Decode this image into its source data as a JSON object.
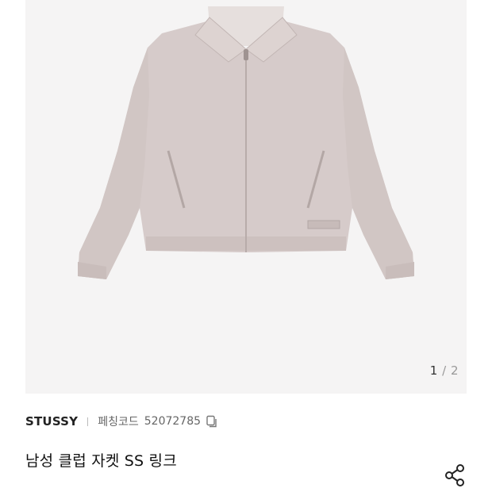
{
  "gallery": {
    "image_alt": "jacket-photo",
    "current_page": "1",
    "separator": "/",
    "total_pages": "2"
  },
  "product": {
    "brand": "STUSSY",
    "code_label": "페칭코드",
    "code_value": "52072785",
    "title": "남성 클럽 자켓 SS 링크"
  },
  "icons": {
    "copy": "copy-icon",
    "share": "share-icon"
  },
  "colors": {
    "jacket": "#d6cbca",
    "gallery_bg": "#f5f4f4"
  }
}
